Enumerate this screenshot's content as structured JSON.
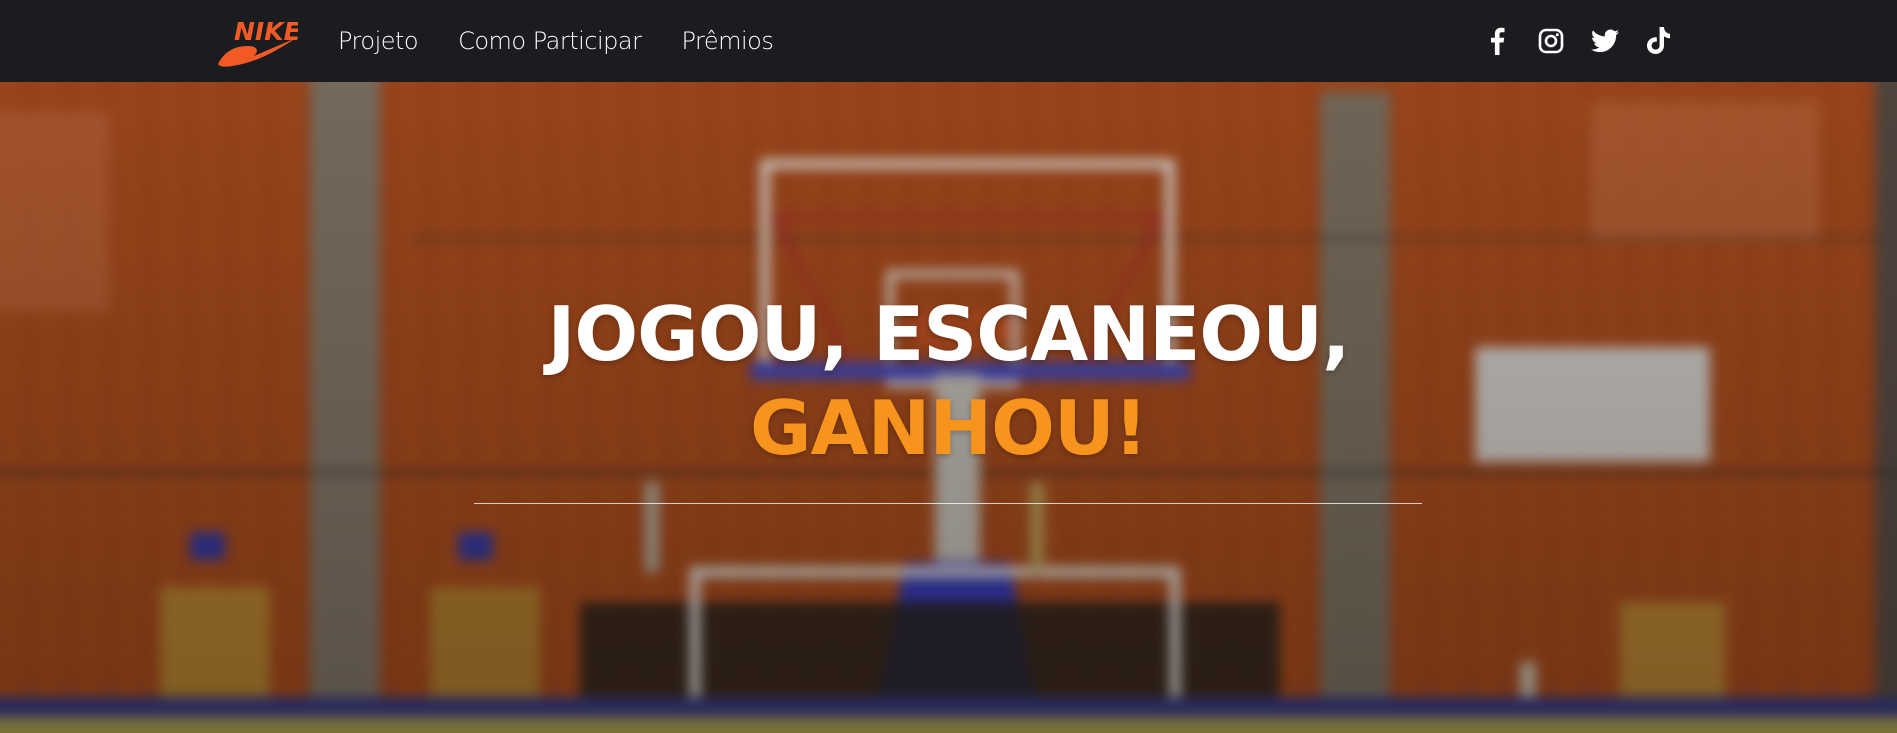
{
  "brand": {
    "logo_text": "NIKE",
    "logo_color": "#f15a24"
  },
  "nav": {
    "links": [
      {
        "label": "Projeto"
      },
      {
        "label": "Como Participar"
      },
      {
        "label": "Prêmios"
      }
    ]
  },
  "socials": [
    {
      "icon": "facebook-icon"
    },
    {
      "icon": "instagram-icon"
    },
    {
      "icon": "twitter-icon"
    },
    {
      "icon": "tiktok-icon"
    }
  ],
  "hero": {
    "headline_line1": "JOGOU, ESCANEOU,",
    "headline_line2": "GANHOU!",
    "accent_color": "#f7941d"
  }
}
